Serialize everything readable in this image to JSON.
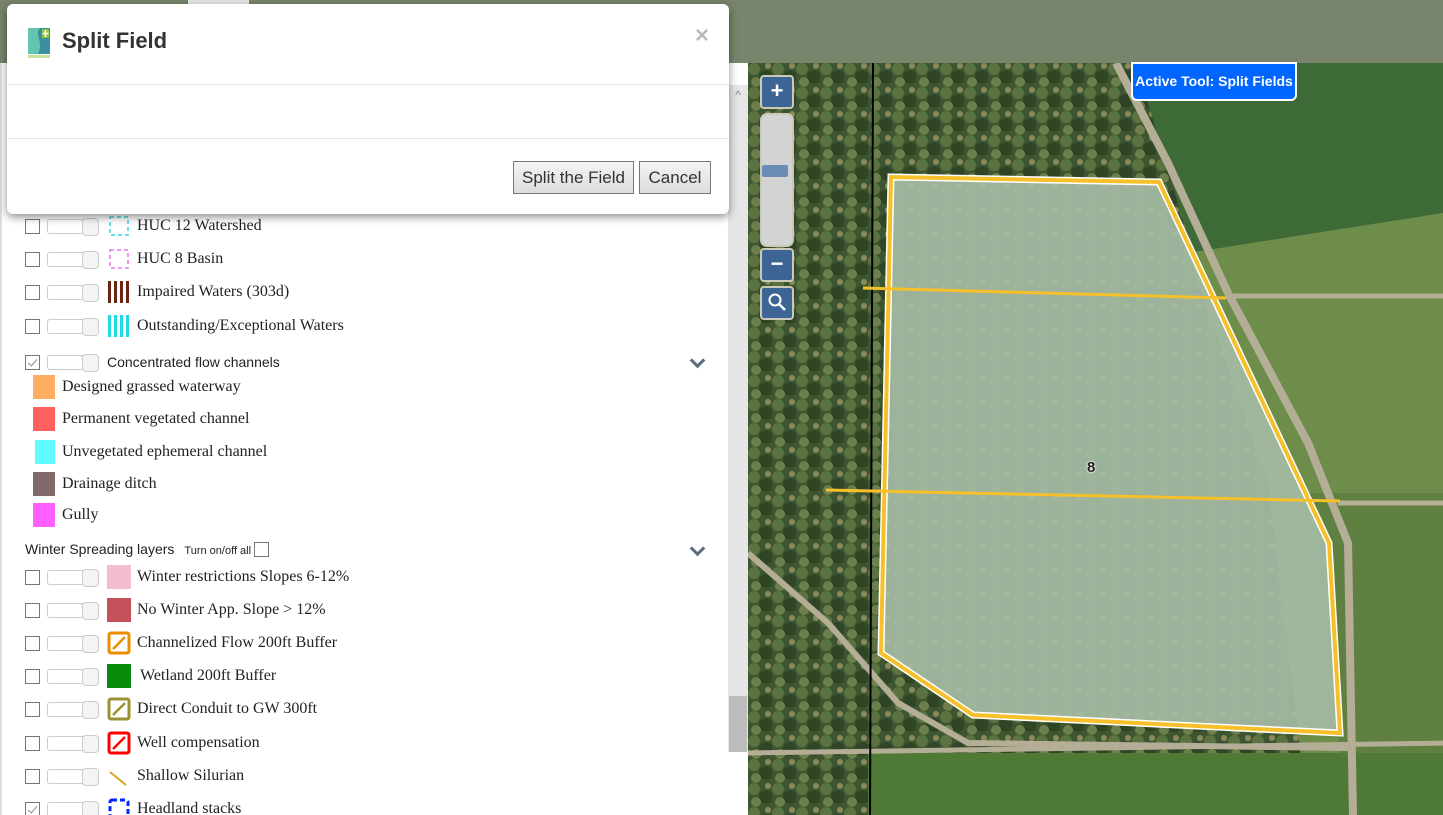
{
  "modal": {
    "title": "Split Field",
    "close_glyph": "×",
    "buttons": {
      "split": "Split the Field",
      "cancel": "Cancel"
    },
    "logo_icon": "snapplus-logo-icon"
  },
  "map": {
    "active_tool": "Active Tool: Split Fields",
    "field_label": "8",
    "zoom_in": "+",
    "zoom_out": "−",
    "colors": {
      "field_outline": "#f5c02a",
      "split_line": "#f5c02a",
      "field_fill": "#9fb5a0",
      "active_tool_bg": "#0066ff"
    }
  },
  "layers": {
    "top_layers": [
      {
        "label": "HUC 12 Watershed",
        "checked": false,
        "icon": "dashed-square-cyan-icon"
      },
      {
        "label": "HUC 8 Basin",
        "checked": false,
        "icon": "dashed-square-magenta-icon"
      },
      {
        "label": "Impaired Waters (303d)",
        "checked": false,
        "icon": "brown-stripes-icon"
      },
      {
        "label": "Outstanding/Exceptional Waters",
        "checked": false,
        "icon": "cyan-stripes-icon"
      }
    ],
    "concentrated_flow": {
      "label": "Concentrated flow channels",
      "checked": true,
      "legend": [
        {
          "label": "Designed grassed waterway",
          "color": "#ffad60"
        },
        {
          "label": "Permanent vegetated channel",
          "color": "#ff6161"
        },
        {
          "label": "Unvegetated ephemeral channel",
          "color": "#5ffbff"
        },
        {
          "label": "Drainage ditch",
          "color": "#82696a"
        },
        {
          "label": "Gully",
          "color": "#ff5fff"
        }
      ]
    },
    "winter": {
      "title": "Winter Spreading layers",
      "turn_all_label": "Turn on/off all",
      "turn_all_checked": false,
      "items": [
        {
          "label": "Winter restrictions Slopes 6-12%",
          "checked": false,
          "icon": "pink-square-icon",
          "color": "#f3bcd1"
        },
        {
          "label": "No Winter App. Slope > 12%",
          "checked": false,
          "icon": "red-square-icon",
          "color": "#c6505a"
        },
        {
          "label": "Channelized Flow 200ft Buffer",
          "checked": false,
          "icon": "orange-hatched-square-icon",
          "color": "#ec8c00"
        },
        {
          "label": "Wetland 200ft Buffer",
          "checked": false,
          "icon": "green-square-icon",
          "color": "#0a8a0a"
        },
        {
          "label": "Direct Conduit to GW 300ft",
          "checked": false,
          "icon": "olive-hatched-square-icon",
          "color": "#9a9132"
        },
        {
          "label": "Well compensation",
          "checked": false,
          "icon": "red-hatched-square-icon",
          "color": "#ff0000"
        },
        {
          "label": "Shallow Silurian",
          "checked": false,
          "icon": "yellow-line-icon",
          "color": "#d9a521"
        },
        {
          "label": "Headland stacks",
          "checked": true,
          "icon": "blue-dashed-square-icon",
          "color": "#0026ff"
        }
      ]
    }
  }
}
